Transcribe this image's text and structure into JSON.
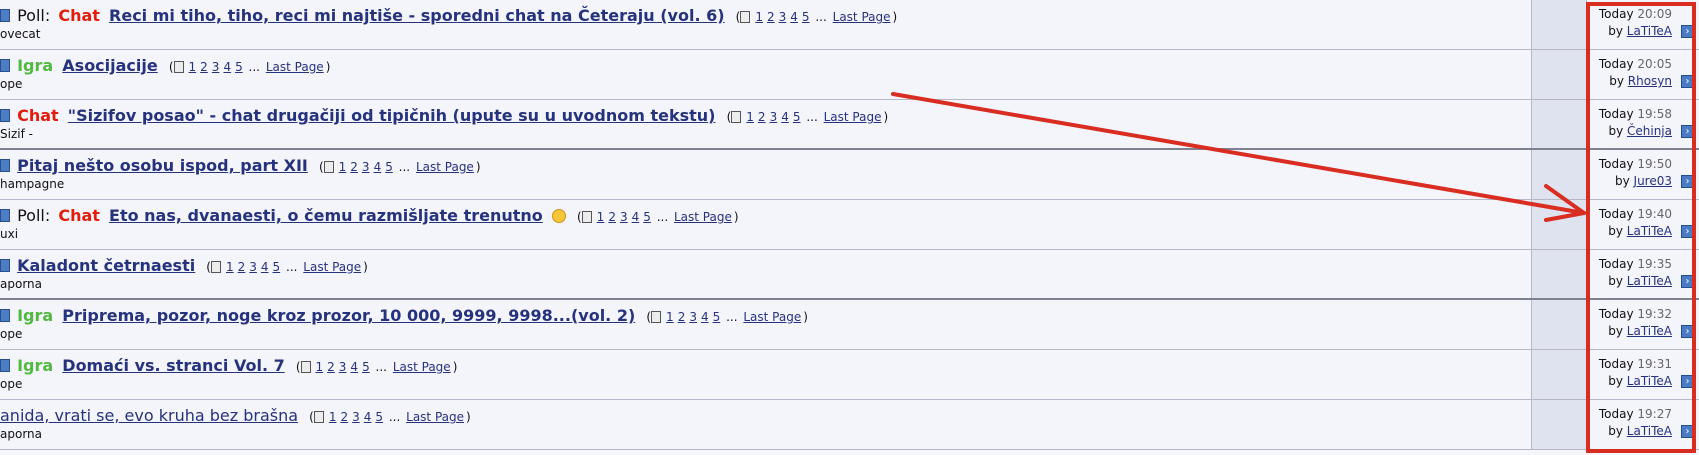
{
  "topics": [
    {
      "prefix_poll": "Poll:",
      "prefix_tag": "Chat",
      "tag_type": "chat",
      "title": "Reci mi tiho, tiho, reci mi najtiše - sporedni chat na Četeraju (vol. 6)",
      "title_bold": true,
      "pages": [
        "1",
        "2",
        "3",
        "4",
        "5"
      ],
      "ellipsis": "...",
      "last_page_label": "Last Page",
      "author": "ovecat",
      "time_today": "Today",
      "time_clock": "20:09",
      "by_label": "by",
      "last_user": "LaTiTeA"
    },
    {
      "prefix_poll": "",
      "prefix_tag": "Igra",
      "tag_type": "igra",
      "title": "Asocijacije",
      "title_bold": true,
      "pages": [
        "1",
        "2",
        "3",
        "4",
        "5"
      ],
      "ellipsis": "...",
      "last_page_label": "Last Page",
      "author": "ope",
      "time_today": "Today",
      "time_clock": "20:05",
      "by_label": "by",
      "last_user": "Rhosyn"
    },
    {
      "prefix_poll": "",
      "prefix_tag": "Chat",
      "tag_type": "chat",
      "title": "\"Sizifov posao\" - chat drugačiji od tipičnih (upute su u uvodnom tekstu)",
      "title_bold": true,
      "pages": [
        "1",
        "2",
        "3",
        "4",
        "5"
      ],
      "ellipsis": "...",
      "last_page_label": "Last Page",
      "author": "Sizif -",
      "time_today": "Today",
      "time_clock": "19:58",
      "by_label": "by",
      "last_user": "Čehinja"
    },
    {
      "prefix_poll": "",
      "prefix_tag": "",
      "tag_type": "none",
      "title": "Pitaj nešto osobu ispod, part XII",
      "title_bold": true,
      "pages": [
        "1",
        "2",
        "3",
        "4",
        "5"
      ],
      "ellipsis": "...",
      "last_page_label": "Last Page",
      "author": "hampagne",
      "time_today": "Today",
      "time_clock": "19:50",
      "by_label": "by",
      "last_user": "Jure03"
    },
    {
      "prefix_poll": "Poll:",
      "prefix_tag": "Chat",
      "tag_type": "chat",
      "title": "Eto nas, dvanaesti, o čemu razmišljate trenutno",
      "title_bold": true,
      "has_emoji": true,
      "pages": [
        "1",
        "2",
        "3",
        "4",
        "5"
      ],
      "ellipsis": "...",
      "last_page_label": "Last Page",
      "author": "uxi",
      "time_today": "Today",
      "time_clock": "19:40",
      "by_label": "by",
      "last_user": "LaTiTeA"
    },
    {
      "prefix_poll": "",
      "prefix_tag": "",
      "tag_type": "none",
      "title": "Kaladont četrnaesti",
      "title_bold": true,
      "pages": [
        "1",
        "2",
        "3",
        "4",
        "5"
      ],
      "ellipsis": "...",
      "last_page_label": "Last Page",
      "author": "aporna",
      "time_today": "Today",
      "time_clock": "19:35",
      "by_label": "by",
      "last_user": "LaTiTeA"
    },
    {
      "prefix_poll": "",
      "prefix_tag": "Igra",
      "tag_type": "igra",
      "title": "Priprema, pozor, noge kroz prozor, 10 000, 9999, 9998...(vol. 2)",
      "title_bold": true,
      "pages": [
        "1",
        "2",
        "3",
        "4",
        "5"
      ],
      "ellipsis": "...",
      "last_page_label": "Last Page",
      "author": "ope",
      "time_today": "Today",
      "time_clock": "19:32",
      "by_label": "by",
      "last_user": "LaTiTeA"
    },
    {
      "prefix_poll": "",
      "prefix_tag": "Igra",
      "tag_type": "igra",
      "title": "Domaći vs. stranci Vol. 7",
      "title_bold": true,
      "pages": [
        "1",
        "2",
        "3",
        "4",
        "5"
      ],
      "ellipsis": "...",
      "last_page_label": "Last Page",
      "author": "ope",
      "time_today": "Today",
      "time_clock": "19:31",
      "by_label": "by",
      "last_user": "LaTiTeA"
    },
    {
      "prefix_poll": "",
      "prefix_tag": "",
      "tag_type": "none",
      "title": "anida, vrati se, evo kruha bez brašna",
      "title_bold": false,
      "pages": [
        "1",
        "2",
        "3",
        "4",
        "5"
      ],
      "ellipsis": "...",
      "last_page_label": "Last Page",
      "author": "aporna",
      "time_today": "Today",
      "time_clock": "19:27",
      "by_label": "by",
      "last_user": "LaTiTeA"
    }
  ],
  "icons": {
    "topic_icon": "topic-icon",
    "pages_icon": "multipage-icon",
    "goto_icon": "go-to-last-post-icon",
    "emoji_icon": "smiley-emoji-icon"
  },
  "colors": {
    "chat": "#e21d0b",
    "igra": "#52b940",
    "link": "#25327c",
    "annotation": "#d92d21"
  }
}
